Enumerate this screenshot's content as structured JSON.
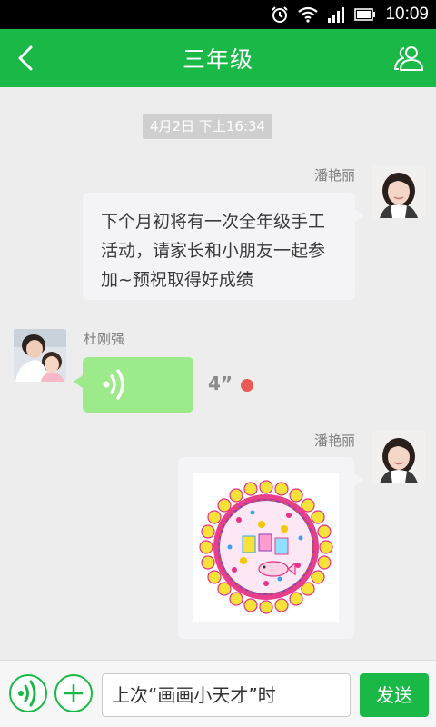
{
  "status_bar": {
    "time": "10:09",
    "icons": [
      "alarm-icon",
      "wifi-icon",
      "signal-icon",
      "battery-icon"
    ]
  },
  "header": {
    "title": "三年级",
    "back_icon": "chevron-left-icon",
    "members_icon": "group-members-icon"
  },
  "chat": {
    "timestamp": "4月2日 下上16:34",
    "messages": [
      {
        "sender": "潘艳丽",
        "side": "right",
        "type": "text",
        "text": "下个月初将有一次全年级手工活动，请家长和小朋友一起参加~预祝取得好成绩"
      },
      {
        "sender": "杜刚强",
        "side": "left",
        "type": "voice",
        "duration": "4”",
        "unread": true
      },
      {
        "sender": "潘艳丽",
        "side": "right",
        "type": "image",
        "image_icon": "child-drawing-image"
      }
    ]
  },
  "input_bar": {
    "voice_icon": "voice-icon",
    "add_icon": "plus-icon",
    "input_value": "上次“画画小天才”时",
    "send_label": "发送"
  },
  "colors": {
    "brand_green": "#1ab947",
    "voice_bubble": "#9cea89",
    "unread_red": "#ea5a56"
  }
}
